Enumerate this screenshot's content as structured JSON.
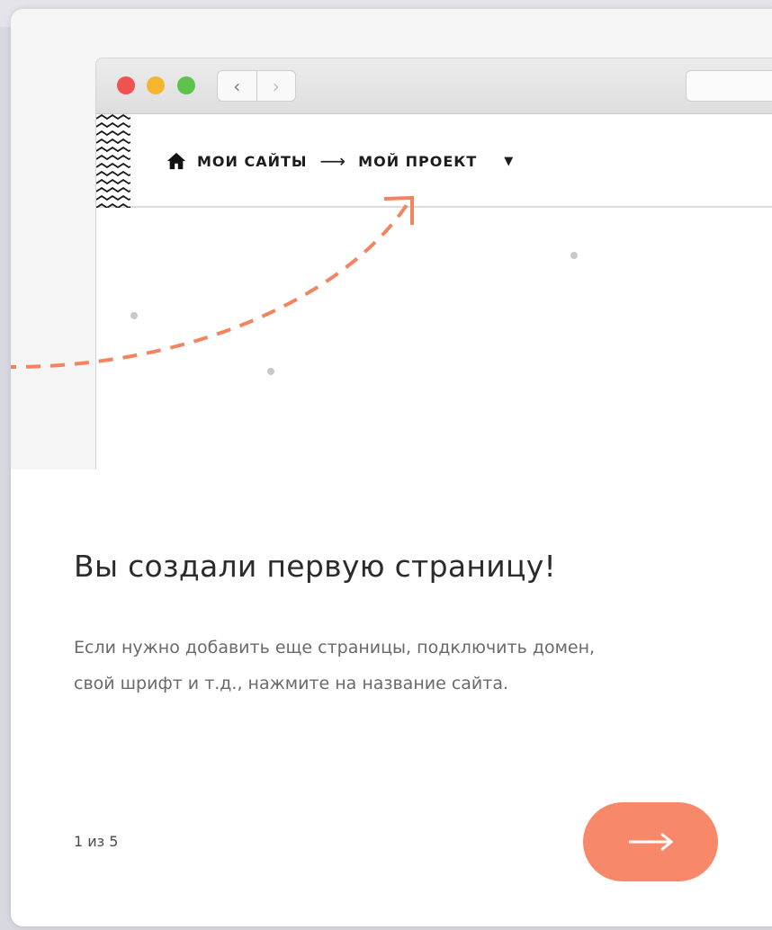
{
  "illustration": {
    "breadcrumb": {
      "home_icon": "home-icon",
      "my_sites": "МОИ САЙТЫ",
      "separator": "⟶",
      "my_project": "МОЙ ПРОЕКТ",
      "caret": "▼"
    },
    "nav": {
      "back": "‹",
      "forward": "›"
    },
    "accent_color": "#f4845f"
  },
  "content": {
    "title": "Вы создали первую страницу!",
    "description_line1": "Если нужно добавить еще страницы, подключить домен,",
    "description_line2": "свой шрифт и т.д., нажмите на название сайта.",
    "pager": "1 из 5",
    "next_button_icon": "arrow-right-icon",
    "next_button_color": "#f8886a"
  }
}
